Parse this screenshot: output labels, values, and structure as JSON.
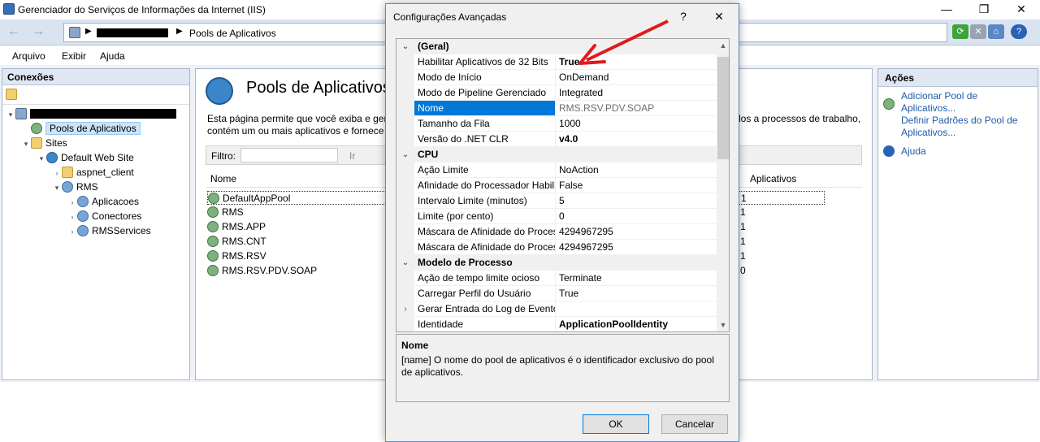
{
  "window": {
    "title": "Gerenciador do Serviços de Informações da Internet (IIS)",
    "min": "—",
    "max": "❐",
    "close": "✕"
  },
  "nav": {
    "back": "←",
    "fwd": "→",
    "crumb_sep": "▶",
    "crumb": "Pools de Aplicativos",
    "refresh": "⟳",
    "stop": "✕",
    "home": "⌂",
    "help": "?"
  },
  "menu": [
    "Arquivo",
    "Exibir",
    "Ajuda"
  ],
  "connections": {
    "header": "Conexões",
    "tree": [
      {
        "label": "",
        "indent": 0,
        "tw": "▾",
        "icon": "server"
      },
      {
        "label": "Pools de Aplicativos",
        "indent": 1,
        "tw": "",
        "icon": "pool",
        "selected": true
      },
      {
        "label": "Sites",
        "indent": 1,
        "tw": "▾",
        "icon": "folder"
      },
      {
        "label": "Default Web Site",
        "indent": 2,
        "tw": "▾",
        "icon": "globe"
      },
      {
        "label": "aspnet_client",
        "indent": 3,
        "tw": "›",
        "icon": "folder"
      },
      {
        "label": "RMS",
        "indent": 3,
        "tw": "▾",
        "icon": "app"
      },
      {
        "label": "Aplicacoes",
        "indent": 4,
        "tw": "›",
        "icon": "app"
      },
      {
        "label": "Conectores",
        "indent": 4,
        "tw": "›",
        "icon": "app"
      },
      {
        "label": "RMSServices",
        "indent": 4,
        "tw": "›",
        "icon": "app"
      }
    ]
  },
  "main": {
    "title": "Pools de Aplicativos",
    "desc1": "Esta página permite que você exiba e gere",
    "desc1b": "los a processos de trabalho,",
    "desc2": "contém um ou mais aplicativos e fornece",
    "filter_label": "Filtro:",
    "filter_go": "Ir",
    "col_name": "Nome",
    "col_apps": "Aplicativos",
    "rows": [
      {
        "name": "DefaultAppPool",
        "apps": "1"
      },
      {
        "name": "RMS",
        "apps": "1"
      },
      {
        "name": "RMS.APP",
        "apps": "1"
      },
      {
        "name": "RMS.CNT",
        "apps": "1"
      },
      {
        "name": "RMS.RSV",
        "apps": "1"
      },
      {
        "name": "RMS.RSV.PDV.SOAP",
        "apps": "0"
      }
    ]
  },
  "actions": {
    "header": "Ações",
    "add": "Adicionar Pool de Aplicativos...",
    "defaults": "Definir Padrões do Pool de Aplicativos...",
    "help": "Ajuda"
  },
  "dialog": {
    "title": "Configurações Avançadas",
    "help": "?",
    "close": "✕",
    "rows": [
      {
        "cat": true,
        "tw": "⌄",
        "name": "(Geral)"
      },
      {
        "name": "Habilitar Aplicativos de 32 Bits",
        "value": "True",
        "bold": true
      },
      {
        "name": "Modo de Início",
        "value": "OnDemand"
      },
      {
        "name": "Modo de Pipeline Gerenciado",
        "value": "Integrated"
      },
      {
        "name": "Nome",
        "value": "RMS.RSV.PDV.SOAP",
        "selected": true
      },
      {
        "name": "Tamanho da Fila",
        "value": "1000"
      },
      {
        "name": "Versão do .NET CLR",
        "value": "v4.0",
        "bold": true
      },
      {
        "cat": true,
        "tw": "⌄",
        "name": "CPU"
      },
      {
        "name": "Ação Limite",
        "value": "NoAction"
      },
      {
        "name": "Afinidade do Processador Habili",
        "value": "False"
      },
      {
        "name": "Intervalo Limite (minutos)",
        "value": "5"
      },
      {
        "name": "Limite (por cento)",
        "value": "0"
      },
      {
        "name": "Máscara de Afinidade do Proces",
        "value": "4294967295"
      },
      {
        "name": "Máscara de Afinidade do Proces",
        "value": "4294967295"
      },
      {
        "cat": true,
        "tw": "⌄",
        "name": "Modelo de Processo"
      },
      {
        "name": "Ação de tempo limite ocioso",
        "value": "Terminate"
      },
      {
        "name": "Carregar Perfil do Usuário",
        "value": "True"
      },
      {
        "name": "Gerar Entrada do Log de Eventos",
        "value": "",
        "tw": "›"
      },
      {
        "name": "Identidade",
        "value": "ApplicationPoolIdentity",
        "bold": true
      }
    ],
    "desc_name": "Nome",
    "desc_text": "[name] O nome do pool de aplicativos é o identificador exclusivo do pool de aplicativos.",
    "ok": "OK",
    "cancel": "Cancelar"
  },
  "colors": {
    "selection": "#0078d7",
    "arrow": "#e01b1b",
    "link": "#1e5aa8"
  }
}
